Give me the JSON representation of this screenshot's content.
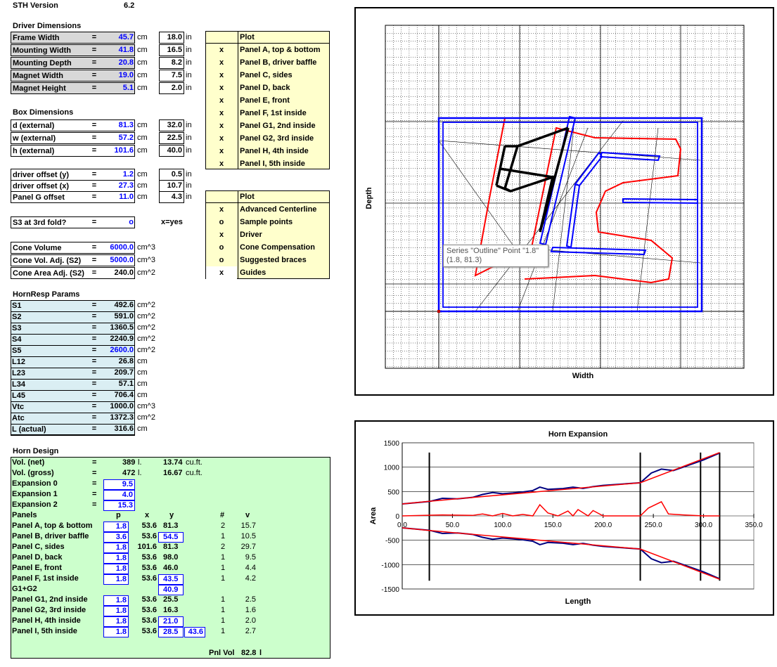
{
  "version": {
    "label": "STH Version",
    "value": "6.2"
  },
  "driver": {
    "title": "Driver Dimensions",
    "rows": [
      {
        "name": "Frame Width",
        "cm": "45.7",
        "in": "18.0"
      },
      {
        "name": "Mounting Width",
        "cm": "41.8",
        "in": "16.5"
      },
      {
        "name": "Mounting Depth",
        "cm": "20.8",
        "in": "8.2"
      },
      {
        "name": "Magnet Width",
        "cm": "19.0",
        "in": "7.5"
      },
      {
        "name": "Magnet Height",
        "cm": "5.1",
        "in": "2.0"
      }
    ]
  },
  "box": {
    "title": "Box Dimensions",
    "rows": [
      {
        "name": "d (external)",
        "cm": "81.3",
        "in": "32.0"
      },
      {
        "name": "w (external)",
        "cm": "57.2",
        "in": "22.5"
      },
      {
        "name": "h (external)",
        "cm": "101.6",
        "in": "40.0"
      }
    ],
    "offsets": [
      {
        "name": "driver offset (y)",
        "cm": "1.2",
        "in": "0.5"
      },
      {
        "name": "driver offset (x)",
        "cm": "27.3",
        "in": "10.7"
      },
      {
        "name": "Panel G offset",
        "cm": "11.0",
        "in": "4.3"
      }
    ]
  },
  "units": {
    "cm": "cm",
    "in": "in",
    "eq": "=",
    "cm2": "cm^2",
    "cm3": "cm^3",
    "l": "l.",
    "cuft": "cu.ft."
  },
  "s3fold": {
    "label": "S3 at 3rd fold?",
    "value": "o",
    "hint": "x=yes"
  },
  "cone": [
    {
      "name": "Cone Volume",
      "value": "6000.0",
      "unit": "cm^3"
    },
    {
      "name": "Cone Vol. Adj. (S2)",
      "value": "5000.0",
      "unit": "cm^3"
    },
    {
      "name": "Cone Area Adj. (S2)",
      "value": "240.0",
      "unit": "cm^2"
    }
  ],
  "plot1": {
    "title": "Plot",
    "rows": [
      {
        "mark": "x",
        "label": "Panel A, top & bottom"
      },
      {
        "mark": "x",
        "label": "Panel B, driver baffle"
      },
      {
        "mark": "x",
        "label": "Panel C, sides"
      },
      {
        "mark": "x",
        "label": "Panel D, back"
      },
      {
        "mark": "x",
        "label": "Panel E, front"
      },
      {
        "mark": "x",
        "label": "Panel F, 1st inside"
      },
      {
        "mark": "x",
        "label": "Panel G1, 2nd inside"
      },
      {
        "mark": "x",
        "label": "Panel G2, 3rd inside"
      },
      {
        "mark": "x",
        "label": "Panel H, 4th inside"
      },
      {
        "mark": "x",
        "label": "Panel I, 5th inside"
      }
    ]
  },
  "plot2": {
    "title": "Plot",
    "rows": [
      {
        "mark": "x",
        "label": "Advanced Centerline"
      },
      {
        "mark": "o",
        "label": "Sample points"
      },
      {
        "mark": "x",
        "label": "Driver"
      },
      {
        "mark": "o",
        "label": "Cone Compensation"
      },
      {
        "mark": "o",
        "label": "Suggested braces"
      },
      {
        "mark": "x",
        "label": "Guides"
      }
    ]
  },
  "hornresp": {
    "title": "HornResp Params",
    "rows": [
      {
        "name": "S1",
        "value": "492.6",
        "unit": "cm^2",
        "blue": false
      },
      {
        "name": "S2",
        "value": "591.0",
        "unit": "cm^2",
        "blue": false
      },
      {
        "name": "S3",
        "value": "1360.5",
        "unit": "cm^2",
        "blue": false
      },
      {
        "name": "S4",
        "value": "2240.9",
        "unit": "cm^2",
        "blue": false
      },
      {
        "name": "S5",
        "value": "2600.0",
        "unit": "cm^2",
        "blue": true
      },
      {
        "name": "L12",
        "value": "26.8",
        "unit": "cm",
        "blue": false
      },
      {
        "name": "L23",
        "value": "209.7",
        "unit": "cm",
        "blue": false
      },
      {
        "name": "L34",
        "value": "57.1",
        "unit": "cm",
        "blue": false
      },
      {
        "name": "L45",
        "value": "706.4",
        "unit": "cm",
        "blue": false
      },
      {
        "name": "Vtc",
        "value": "1000.0",
        "unit": "cm^3",
        "blue": false
      },
      {
        "name": "Atc",
        "value": "1372.3",
        "unit": "cm^2",
        "blue": false
      },
      {
        "name": "L (actual)",
        "value": "316.6",
        "unit": "cm",
        "blue": false
      }
    ]
  },
  "horn": {
    "title": "Horn Design",
    "vol_net": {
      "name": "Vol. (net)",
      "l": "389",
      "cuft": "13.74"
    },
    "vol_gross": {
      "name": "Vol. (gross)",
      "l": "472",
      "cuft": "16.67"
    },
    "expansions": [
      {
        "name": "Expansion 0",
        "value": "9.5"
      },
      {
        "name": "Expansion 1",
        "value": "4.0"
      },
      {
        "name": "Expansion 2",
        "value": "15.3"
      }
    ],
    "headers": {
      "panels": "Panels",
      "p": "p",
      "x": "x",
      "y": "y",
      "n": "#",
      "v": "v"
    },
    "panels": [
      {
        "name": "Panel A, top & bottom",
        "p": "1.8",
        "x": "53.6",
        "y": "81.3",
        "n": "2",
        "v": "15.7",
        "ybox": false
      },
      {
        "name": "Panel B, driver baffle",
        "p": "3.6",
        "x": "53.6",
        "y": "54.5",
        "n": "1",
        "v": "10.5",
        "ybox": true
      },
      {
        "name": "Panel C, sides",
        "p": "1.8",
        "x": "101.6",
        "y": "81.3",
        "n": "2",
        "v": "29.7",
        "ybox": false
      },
      {
        "name": "Panel D, back",
        "p": "1.8",
        "x": "53.6",
        "y": "98.0",
        "n": "1",
        "v": "9.5",
        "ybox": false
      },
      {
        "name": "Panel E, front",
        "p": "1.8",
        "x": "53.6",
        "y": "46.0",
        "n": "1",
        "v": "4.4",
        "ybox": false
      },
      {
        "name": "Panel F, 1st inside",
        "p": "1.8",
        "x": "53.6",
        "y": "43.5",
        "n": "1",
        "v": "4.2",
        "ybox": true
      }
    ],
    "g12": {
      "name": "G1+G2",
      "y": "40.9"
    },
    "panels2": [
      {
        "name": "Panel G1, 2nd inside",
        "p": "1.8",
        "x": "53.6",
        "y": "25.5",
        "n": "1",
        "v": "2.5",
        "ybox": false
      },
      {
        "name": "Panel G2, 3rd inside",
        "p": "1.8",
        "x": "53.6",
        "y": "16.3",
        "n": "1",
        "v": "1.6",
        "ybox": false
      },
      {
        "name": "Panel H, 4th inside",
        "p": "1.8",
        "x": "53.6",
        "y": "21.0",
        "n": "1",
        "v": "2.0",
        "ybox": true
      },
      {
        "name": "Panel I, 5th inside",
        "p": "1.8",
        "x": "53.6",
        "y": "28.5",
        "n": "1",
        "v": "2.7",
        "ybox": true,
        "extra": "43.6"
      }
    ],
    "pnlvol": {
      "label": "Pnl Vol",
      "value": "82.8",
      "unit": "l"
    }
  },
  "layout_chart": {
    "xlabel": "Width",
    "ylabel": "Depth",
    "tooltip_title": "Series \"Outline\" Point \"1.8\"",
    "tooltip_value": "(1.8, 81.3)"
  },
  "chart_data": {
    "type": "line",
    "title": "Horn Expansion",
    "xlabel": "Length",
    "ylabel": "Area",
    "xlim": [
      0,
      350
    ],
    "ylim": [
      -1500,
      1500
    ],
    "x_ticks": [
      "0.0",
      "50.0",
      "100.0",
      "150.0",
      "200.0",
      "250.0",
      "300.0",
      "350.0"
    ],
    "y_ticks": [
      "1500",
      "1000",
      "500",
      "0",
      "-500",
      "-1000",
      "-1500"
    ],
    "vertical_markers": [
      27,
      237,
      297,
      316
    ],
    "series": [
      {
        "color": "#000080",
        "values_x": [
          0,
          27,
          40,
          55,
          70,
          80,
          90,
          100,
          110,
          120,
          130,
          137,
          145,
          160,
          170,
          180,
          190,
          200,
          237,
          248,
          258,
          270,
          285,
          300,
          316
        ],
        "values_y": [
          246,
          295,
          360,
          350,
          380,
          440,
          480,
          455,
          470,
          490,
          520,
          590,
          545,
          560,
          590,
          565,
          600,
          625,
          680,
          880,
          960,
          930,
          1040,
          1150,
          1290
        ]
      },
      {
        "color": "#ff0000",
        "values_x": [
          0,
          27,
          237,
          316
        ],
        "values_y": [
          246,
          300,
          680,
          1300
        ]
      },
      {
        "color": "#000080",
        "values_x": [
          0,
          27,
          40,
          55,
          70,
          80,
          90,
          100,
          110,
          120,
          130,
          137,
          145,
          160,
          170,
          180,
          190,
          200,
          237,
          248,
          258,
          270,
          285,
          300,
          316
        ],
        "values_y": [
          -246,
          -295,
          -360,
          -350,
          -380,
          -440,
          -480,
          -455,
          -470,
          -490,
          -520,
          -590,
          -545,
          -560,
          -590,
          -565,
          -600,
          -625,
          -680,
          -880,
          -960,
          -930,
          -1040,
          -1150,
          -1290
        ]
      },
      {
        "color": "#ff0000",
        "values_x": [
          0,
          27,
          237,
          316
        ],
        "values_y": [
          -246,
          -300,
          -680,
          -1300
        ]
      },
      {
        "color": "#ff0000",
        "values_x": [
          0,
          40,
          70,
          80,
          90,
          100,
          110,
          120,
          130,
          137,
          145,
          155,
          165,
          170,
          175,
          185,
          190,
          200,
          237,
          245,
          258,
          265,
          280,
          300,
          316
        ],
        "values_y": [
          0,
          20,
          10,
          40,
          0,
          50,
          0,
          30,
          0,
          230,
          60,
          0,
          100,
          0,
          130,
          0,
          110,
          0,
          0,
          160,
          290,
          40,
          20,
          0,
          0
        ]
      }
    ]
  }
}
